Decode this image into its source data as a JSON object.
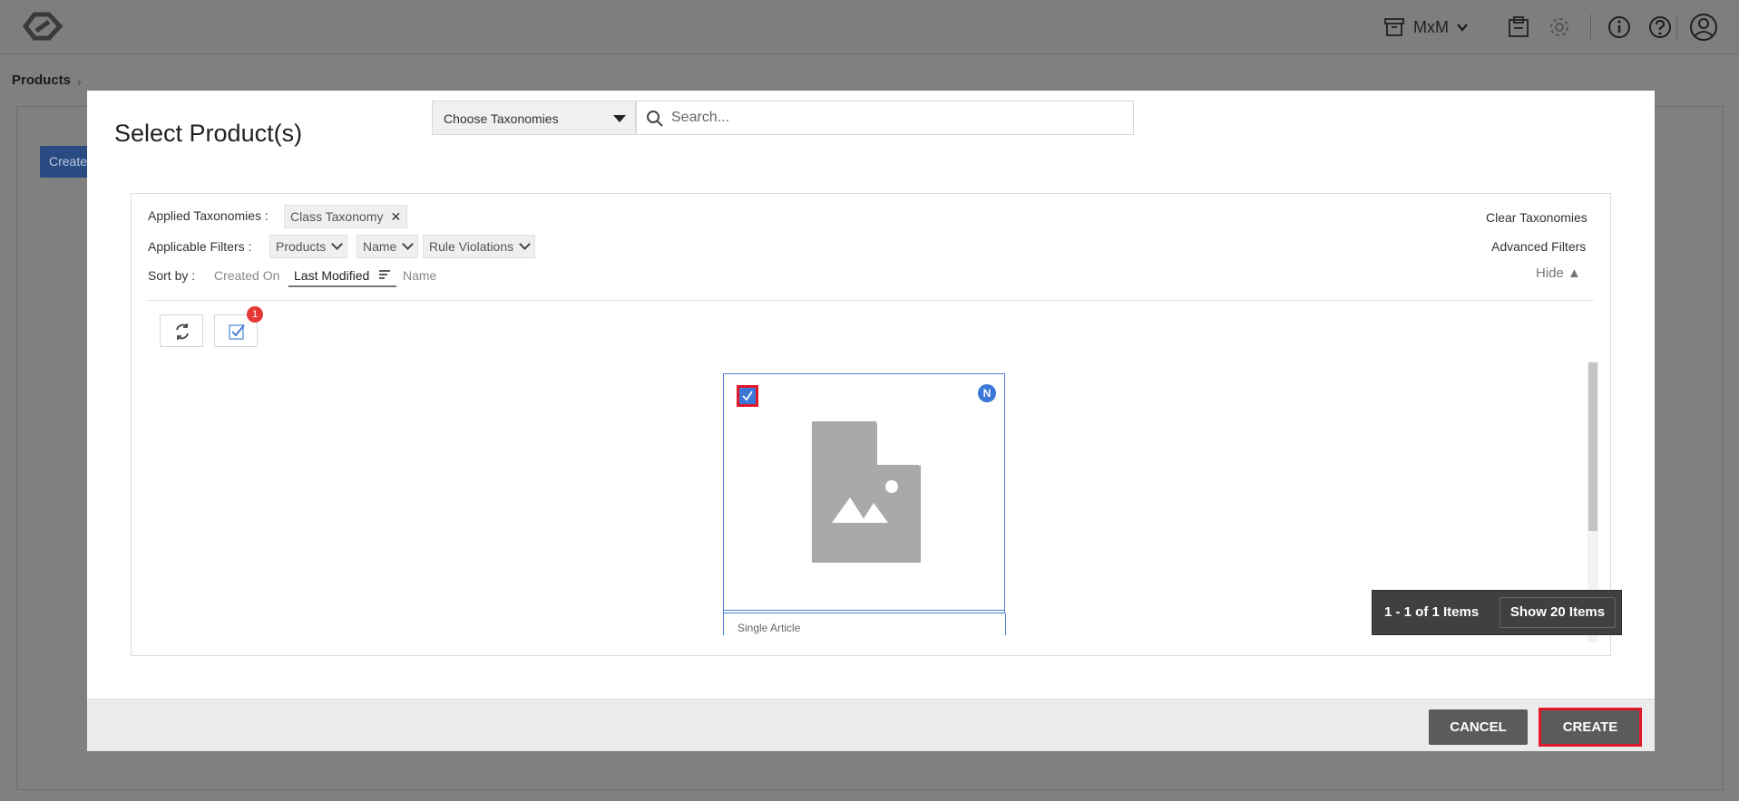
{
  "app": {
    "workspace_label": "MxM",
    "breadcrumb": "Products",
    "background_button_label": "Create"
  },
  "modal": {
    "title": "Select Product(s)",
    "taxonomy_select_label": "Choose Taxonomies",
    "search_placeholder": "Search...",
    "applied_taxonomies_label": "Applied Taxonomies :",
    "applied_taxonomies": [
      "Class Taxonomy"
    ],
    "applicable_filters_label": "Applicable Filters :",
    "filters": [
      "Products",
      "Name",
      "Rule Violations"
    ],
    "sort_label": "Sort by :",
    "sort_options": [
      "Created On",
      "Last Modified",
      "Name"
    ],
    "sort_active": "Last Modified",
    "clear_taxonomies": "Clear Taxonomies",
    "advanced_filters": "Advanced Filters",
    "hide_label": "Hide ▲",
    "selected_count": "1",
    "card": {
      "badge": "N",
      "type": "Single Article",
      "checked": true
    },
    "pager": {
      "count_text": "1 - 1 of 1 Items",
      "show_button": "Show 20 Items"
    },
    "cancel_label": "CANCEL",
    "create_label": "CREATE"
  },
  "colors": {
    "accent": "#3b77d6",
    "highlight": "#e0192a",
    "button_dark": "#5b5b5b"
  }
}
